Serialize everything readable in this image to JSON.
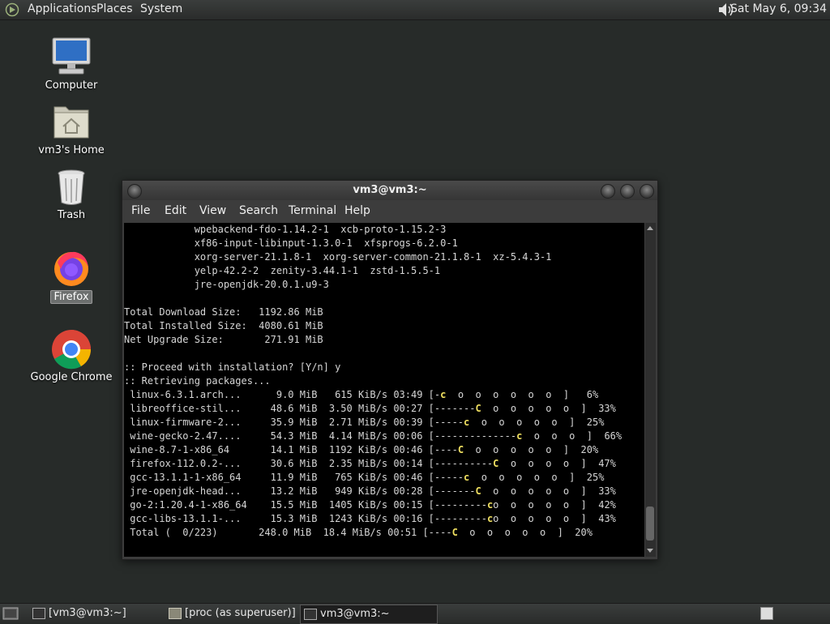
{
  "top_panel": {
    "menus": [
      "Applications",
      "Places",
      "System"
    ],
    "clock": "Sat May  6, 09:34",
    "icons": [
      "distro-logo-icon",
      "volume-icon"
    ]
  },
  "desktop_icons": [
    {
      "label": "Computer",
      "icon": "computer-icon"
    },
    {
      "label": "vm3's Home",
      "icon": "home-folder-icon"
    },
    {
      "label": "Trash",
      "icon": "trash-icon"
    },
    {
      "label": "Firefox",
      "icon": "firefox-icon"
    },
    {
      "label": "Google Chrome",
      "icon": "chrome-icon"
    }
  ],
  "window": {
    "title": "vm3@vm3:~",
    "menus": [
      "File",
      "Edit",
      "View",
      "Search",
      "Terminal",
      "Help"
    ]
  },
  "terminal": {
    "package_lines": [
      "            wpebackend-fdo-1.14.2-1  xcb-proto-1.15.2-3",
      "            xf86-input-libinput-1.3.0-1  xfsprogs-6.2.0-1",
      "            xorg-server-21.1.8-1  xorg-server-common-21.1.8-1  xz-5.4.3-1",
      "            yelp-42.2-2  zenity-3.44.1-1  zstd-1.5.5-1",
      "            jre-openjdk-20.0.1.u9-3"
    ],
    "summary_lines": [
      "Total Download Size:   1192.86 MiB",
      "Total Installed Size:  4080.61 MiB",
      "Net Upgrade Size:       271.91 MiB"
    ],
    "prompt_line": ":: Proceed with installation? [Y/n] y",
    "retrieving_line": ":: Retrieving packages...",
    "downloads": [
      {
        "prefix": " linux-6.3.1.arch...      9.0 MiB   615 KiB/s 03:49 [-",
        "pac": "c",
        "suffix": "  o  o  o  o  o  o  ]   6%"
      },
      {
        "prefix": " libreoffice-stil...     48.6 MiB  3.50 MiB/s 00:27 [-------",
        "pac": "C",
        "suffix": "  o  o  o  o  o  ]  33%"
      },
      {
        "prefix": " linux-firmware-2...     35.9 MiB  2.71 MiB/s 00:39 [-----",
        "pac": "c",
        "suffix": "  o  o  o  o  o  ]  25%"
      },
      {
        "prefix": " wine-gecko-2.47....     54.3 MiB  4.14 MiB/s 00:06 [--------------",
        "pac": "c",
        "suffix": "  o  o  o  ]  66%"
      },
      {
        "prefix": " wine-8.7-1-x86_64       14.1 MiB  1192 KiB/s 00:46 [----",
        "pac": "C",
        "suffix": "  o  o  o  o  o  ]  20%"
      },
      {
        "prefix": " firefox-112.0.2-...     30.6 MiB  2.35 MiB/s 00:14 [----------",
        "pac": "C",
        "suffix": "  o  o  o  o  ]  47%"
      },
      {
        "prefix": " gcc-13.1.1-1-x86_64     11.9 MiB   765 KiB/s 00:46 [-----",
        "pac": "c",
        "suffix": "  o  o  o  o  o  ]  25%"
      },
      {
        "prefix": " jre-openjdk-head...     13.2 MiB   949 KiB/s 00:28 [-------",
        "pac": "C",
        "suffix": "  o  o  o  o  o  ]  33%"
      },
      {
        "prefix": " go-2:1.20.4-1-x86_64    15.5 MiB  1405 KiB/s 00:15 [---------",
        "pac": "c",
        "suffix": "o  o  o  o  o  ]  42%"
      },
      {
        "prefix": " gcc-libs-13.1.1-...     15.3 MiB  1243 KiB/s 00:16 [---------",
        "pac": "c",
        "suffix": "o  o  o  o  o  ]  43%"
      },
      {
        "prefix": " Total (  0/223)       248.0 MiB  18.4 MiB/s 00:51 [----",
        "pac": "C",
        "suffix": "  o  o  o  o  o  ]  20%"
      }
    ]
  },
  "taskbar": [
    {
      "label": "[vm3@vm3:~]",
      "active": false
    },
    {
      "label": "[proc (as superuser)]",
      "active": false
    },
    {
      "label": "vm3@vm3:~",
      "active": true
    }
  ],
  "colors": {
    "pacman": "#f0e060",
    "terminal_bg": "#000000",
    "desktop_bg": "#272b29"
  }
}
